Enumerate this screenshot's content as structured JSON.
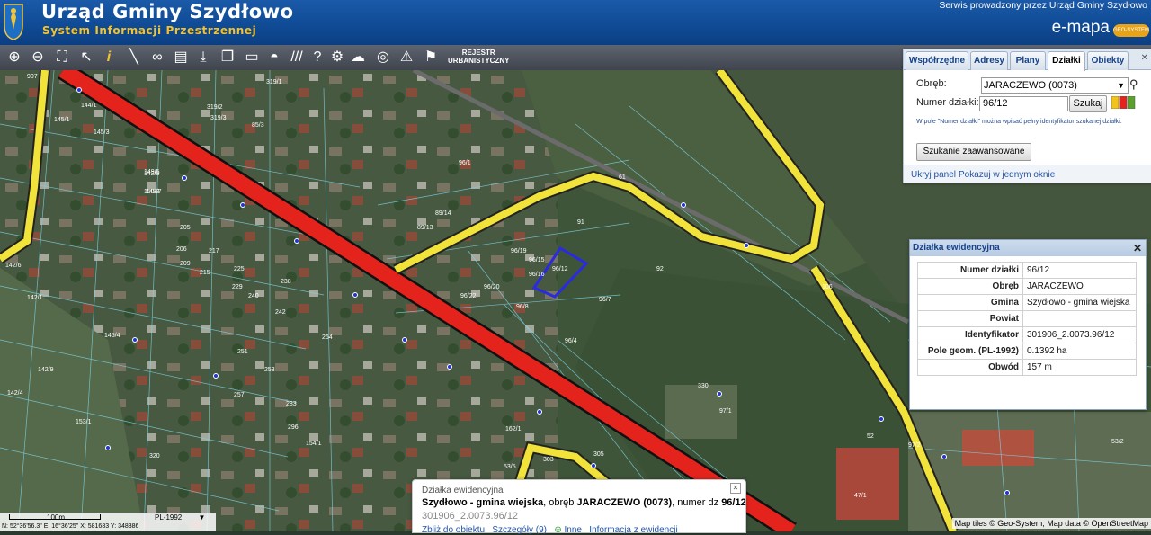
{
  "header": {
    "title": "Urząd Gminy Szydłowo",
    "subtitle": "System Informacji Przestrzennej",
    "provider": "Serwis prowadzony przez Urząd Gminy Szydłowo",
    "brand": "e-mapa"
  },
  "toolbar": {
    "tools": [
      "zoom-in-icon",
      "zoom-out-icon",
      "zoom-extent-icon",
      "pointer-icon",
      "info-icon",
      "measure-icon",
      "link-icon",
      "print-icon",
      "download-icon",
      "layers-icon",
      "layout-icon",
      "comment-icon",
      "hatch-icon",
      "help-icon",
      "settings-icon",
      "cloud-icon",
      "search-map-icon",
      "warning-icon",
      "pin-icon"
    ],
    "rejestr_line1": "REJESTR",
    "rejestr_line2": "URBANISTYCZNY"
  },
  "search_panel": {
    "tabs": [
      "Współrzędne",
      "Adresy",
      "Plany",
      "Działki",
      "Obiekty"
    ],
    "active_tab": "Działki",
    "obreb_label": "Obręb:",
    "obreb_value": "JARACZEWO (0073)",
    "nr_label": "Numer działki:",
    "nr_value": "96/12",
    "search_button": "Szukaj",
    "hint": "W pole \"Numer działki\" można wpisać pełny identyfikator szukanej działki.",
    "advanced_button": "Szukanie zaawansowane",
    "link_hide": "Ukryj panel",
    "link_window": "Pokazuj w jednym oknie"
  },
  "parcel_info": {
    "title": "Działka ewidencyjna",
    "rows": [
      {
        "k": "Numer działki",
        "v": "96/12"
      },
      {
        "k": "Obręb",
        "v": "JARACZEWO"
      },
      {
        "k": "Gmina",
        "v": "Szydłowo - gmina wiejska"
      },
      {
        "k": "Powiat",
        "v": ""
      },
      {
        "k": "Identyfikator",
        "v": "301906_2.0073.96/12"
      },
      {
        "k": "Pole geom. (PL-1992)",
        "v": "0.1392 ha"
      },
      {
        "k": "Obwód",
        "v": "157 m"
      }
    ]
  },
  "popup": {
    "heading": "Działka ewidencyjna",
    "gmina": "Szydłowo - gmina wiejska",
    "text_obreb": ", obręb ",
    "obreb": "JARACZEWO (0073)",
    "text_numer": ", numer dz ",
    "numer": "96/12",
    "identifier": "301906_2.0073.96/12",
    "link_zoom": "Zbliż do obiektu",
    "link_details": "Szczegóły (9)",
    "link_more": "Inne",
    "link_info": "Informacja z ewidencji"
  },
  "map": {
    "scale_label": "100m",
    "projection": "PL-1992",
    "coords": "N: 52°36'56.3\" E: 16°36'25\"  X: 581683  Y: 348386",
    "attribution": "Map tiles © Geo-System; Map data © OpenStreetMap",
    "parcel_labels": [
      "907",
      "144/1",
      "145/3",
      "145/1",
      "85/3",
      "319/1",
      "319/2",
      "319/3",
      "96/1",
      "89/13",
      "89/14",
      "96/19",
      "96/15",
      "96/16",
      "96/12",
      "96/7",
      "96/4",
      "96/20",
      "96/22",
      "96/8",
      "91",
      "92",
      "61",
      "106",
      "149/5",
      "149/7",
      "145/4",
      "205",
      "206",
      "209",
      "215",
      "217",
      "225",
      "229",
      "238",
      "240",
      "242",
      "251",
      "253",
      "257",
      "264",
      "283",
      "296",
      "320",
      "153/1",
      "142/6",
      "142/1",
      "142/9",
      "142/4",
      "142/5",
      "150/3",
      "154/1",
      "162/1",
      "303",
      "305",
      "330",
      "97/1",
      "97/2",
      "52",
      "53/2",
      "47/1",
      "53/5",
      "100"
    ],
    "colors": {
      "red_road": "#e3231c",
      "yellow_road": "#f2e33a",
      "selection": "#2a2ae0",
      "parcel_lines": "#7fd4e8"
    }
  }
}
